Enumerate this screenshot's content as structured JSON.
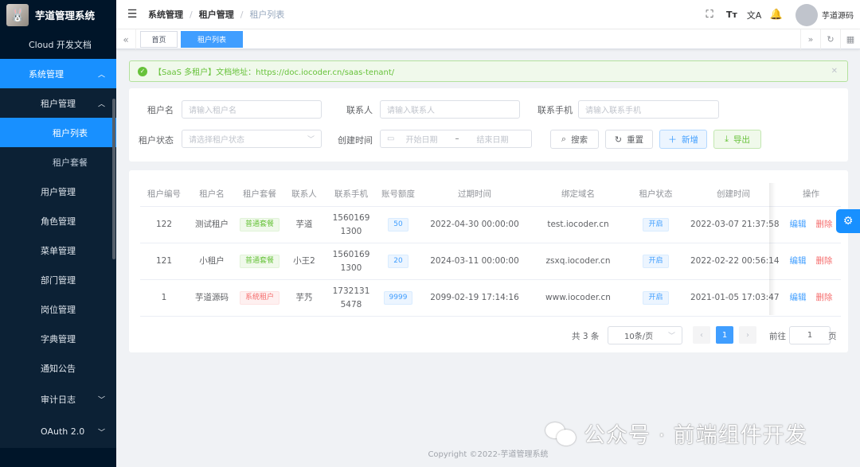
{
  "app": {
    "title": "芋道管理系统"
  },
  "sidebar": {
    "items": [
      {
        "label": "Cloud 开发文档",
        "level": 1
      },
      {
        "label": "系统管理",
        "level": 1,
        "expanded": true
      },
      {
        "label": "租户管理",
        "level": 2,
        "expanded": true
      },
      {
        "label": "租户列表",
        "level": 3,
        "selected": true
      },
      {
        "label": "租户套餐",
        "level": 3
      },
      {
        "label": "用户管理",
        "level": 2
      },
      {
        "label": "角色管理",
        "level": 2
      },
      {
        "label": "菜单管理",
        "level": 2
      },
      {
        "label": "部门管理",
        "level": 2
      },
      {
        "label": "岗位管理",
        "level": 2
      },
      {
        "label": "字典管理",
        "level": 2
      },
      {
        "label": "通知公告",
        "level": 2
      },
      {
        "label": "审计日志",
        "level": 2,
        "has_children": true
      },
      {
        "label": "OAuth 2.0",
        "level": 2,
        "has_children": true
      }
    ]
  },
  "navbar": {
    "breadcrumb": [
      "系统管理",
      "租户管理",
      "租户列表"
    ],
    "username": "芋道源码"
  },
  "tags": {
    "home": "首页",
    "current": "租户列表"
  },
  "alert": {
    "text": "【SaaS 多租户】文档地址：https://doc.iocoder.cn/saas-tenant/"
  },
  "search": {
    "name_label": "租户名",
    "name_placeholder": "请输入租户名",
    "contact_label": "联系人",
    "contact_placeholder": "请输入联系人",
    "phone_label": "联系手机",
    "phone_placeholder": "请输入联系手机",
    "status_label": "租户状态",
    "status_placeholder": "请选择租户状态",
    "time_label": "创建时间",
    "start_placeholder": "开始日期",
    "range_sep": "–",
    "end_placeholder": "结束日期",
    "search_btn": "搜索",
    "reset_btn": "重置",
    "add_btn": "新增",
    "export_btn": "导出"
  },
  "table": {
    "columns": [
      "租户编号",
      "租户名",
      "租户套餐",
      "联系人",
      "联系手机",
      "账号额度",
      "过期时间",
      "绑定域名",
      "租户状态",
      "创建时间",
      "操作"
    ],
    "rows": [
      {
        "id": "122",
        "name": "测试租户",
        "package": "普通套餐",
        "package_color": "#67c23a",
        "contact": "芋道",
        "phone_1": "1560169",
        "phone_2": "1300",
        "quota": "50",
        "expire": "2022-04-30 00:00:00",
        "domain": "test.iocoder.cn",
        "status": "开启",
        "created": "2022-03-07 21:37:58",
        "edit": "编辑",
        "delete": "删除"
      },
      {
        "id": "121",
        "name": "小租户",
        "package": "普通套餐",
        "package_color": "#67c23a",
        "contact": "小王2",
        "phone_1": "1560169",
        "phone_2": "1300",
        "quota": "20",
        "expire": "2024-03-11 00:00:00",
        "domain": "zsxq.iocoder.cn",
        "status": "开启",
        "created": "2022-02-22 00:56:14",
        "edit": "编辑",
        "delete": "删除"
      },
      {
        "id": "1",
        "name": "芋道源码",
        "package": "系统租户",
        "package_color": "#f56c6c",
        "contact": "芋艿",
        "phone_1": "1732131",
        "phone_2": "5478",
        "quota": "9999",
        "expire": "2099-02-19 17:14:16",
        "domain": "www.iocoder.cn",
        "status": "开启",
        "created": "2021-01-05 17:03:47",
        "edit": "编辑",
        "delete": "删除"
      }
    ]
  },
  "pagination": {
    "total_text": "共 3 条",
    "page_size": "10条/页",
    "current_page": "1",
    "goto_label": "前往",
    "goto_value": "1",
    "page_suffix": "页"
  },
  "footer": {
    "copyright": "Copyright ©2022-芋道管理系统"
  },
  "watermark": {
    "text": "公众号 · 前端组件开发"
  },
  "colors": {
    "sidebar_bg": "#001529",
    "primary": "#1890ff",
    "success": "#67c23a",
    "danger": "#f56c6c"
  }
}
